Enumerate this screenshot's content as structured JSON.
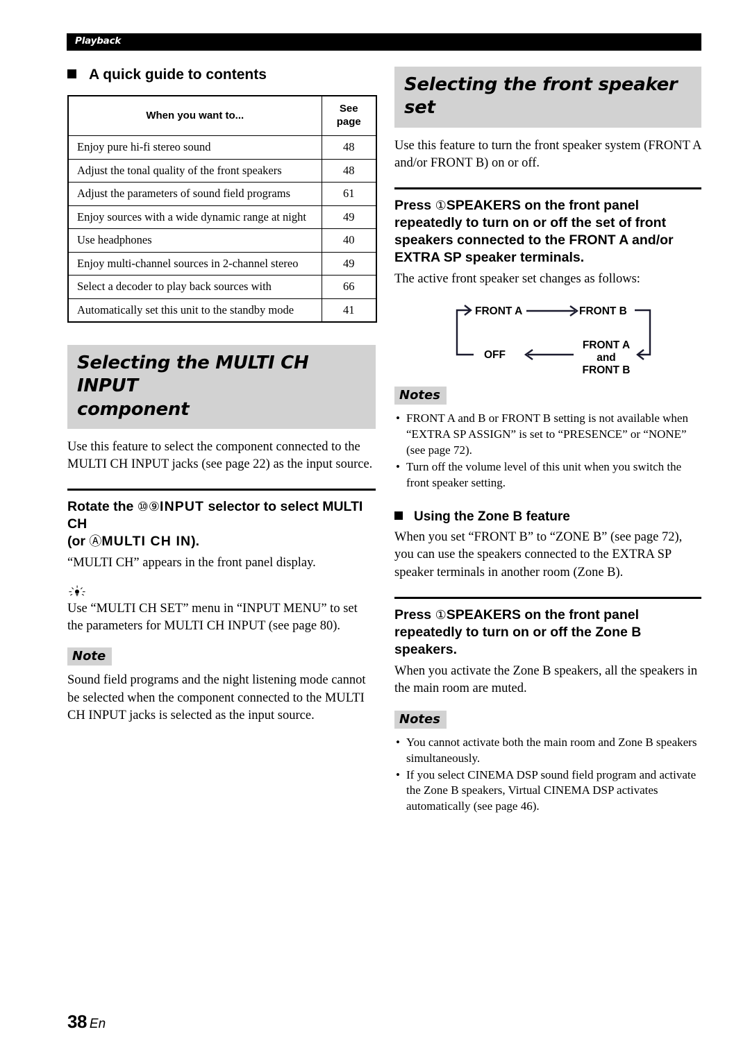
{
  "running_header": {
    "label": "Playback"
  },
  "left_column": {
    "quick_guide": {
      "heading": "A quick guide to contents",
      "columns": [
        "When you want to...",
        "See\npage"
      ],
      "col_header_1": "When you want to...",
      "col_header_2_line1": "See",
      "col_header_2_line2": "page",
      "rows": [
        {
          "task": "Enjoy pure hi-fi stereo sound",
          "page": "48"
        },
        {
          "task": "Adjust the tonal quality of the front speakers",
          "page": "48"
        },
        {
          "task": "Adjust the parameters of sound field programs",
          "page": "61"
        },
        {
          "task": "Enjoy sources with a wide dynamic range at night",
          "page": "49"
        },
        {
          "task": "Use headphones",
          "page": "40"
        },
        {
          "task": "Enjoy multi-channel sources in 2-channel stereo",
          "page": "49"
        },
        {
          "task": "Select a decoder to play back sources with",
          "page": "66"
        },
        {
          "task": "Automatically set this unit to the standby mode",
          "page": "41"
        }
      ]
    },
    "multi_ch": {
      "banner_line1": "Selecting the MULTI CH INPUT",
      "banner_line2": "component",
      "intro": "Use this feature to select the component connected to the MULTI CH INPUT jacks (see page 22) as the input source.",
      "step_prefix": "Rotate the ",
      "step_circle_1": "⑩⑨",
      "step_mid": "INPUT",
      "step_after": " selector to select MULTI CH",
      "step_line2_prefix": "(or ",
      "step_circle_2": "Ⓐ",
      "step_line2_mid": "MULTI CH IN",
      "step_line2_after": ").",
      "step_result": "“MULTI CH” appears in the front panel display.",
      "tip_text": "Use “MULTI CH SET” menu in “INPUT MENU” to set the parameters for MULTI CH INPUT (see page 80).",
      "note_label": "Note",
      "note_text": "Sound field programs and the night listening mode cannot be selected when the component connected to the MULTI CH INPUT jacks is selected as the input source."
    }
  },
  "right_column": {
    "front_speaker": {
      "banner": "Selecting the front speaker set",
      "intro": "Use this feature to turn the front speaker system (FRONT A and/or FRONT B) on or off.",
      "step_prefix": "Press ",
      "step_circle": "①",
      "step_bold": "SPEAKERS",
      "step_rest": " on the front panel repeatedly to turn on or off the set of front speakers connected to the FRONT A and/or EXTRA SP speaker terminals.",
      "step_result": "The active front speaker set changes as follows:",
      "diagram": {
        "nodes": [
          "FRONT A",
          "FRONT B",
          "FRONT A and FRONT B",
          "OFF"
        ],
        "node_3_line1": "FRONT A",
        "node_3_line2": "and",
        "node_3_line3": "FRONT B"
      },
      "notes_label": "Notes",
      "notes": [
        "FRONT A and B or FRONT B setting is not available when “EXTRA SP ASSIGN” is set to “PRESENCE” or “NONE” (see page 72).",
        "Turn off the volume level of this unit when you switch the front speaker setting."
      ]
    },
    "zone_b": {
      "heading": "Using the Zone B feature",
      "intro": "When you set “FRONT B” to “ZONE B” (see page 72), you can use the speakers connected to the EXTRA SP speaker terminals in another room (Zone B).",
      "step_prefix": "Press ",
      "step_circle": "①",
      "step_bold": "SPEAKERS",
      "step_rest": " on the front panel repeatedly to turn on or off the Zone B speakers.",
      "step_result": "When you activate the Zone B speakers, all the speakers in the main room are muted.",
      "notes_label": "Notes",
      "notes": [
        "You cannot activate both the main room and Zone B speakers simultaneously.",
        "If you select CINEMA DSP sound field program and activate the Zone B speakers, Virtual CINEMA DSP activates automatically (see page 46)."
      ]
    }
  },
  "footer": {
    "page_number": "38",
    "language": "En"
  }
}
